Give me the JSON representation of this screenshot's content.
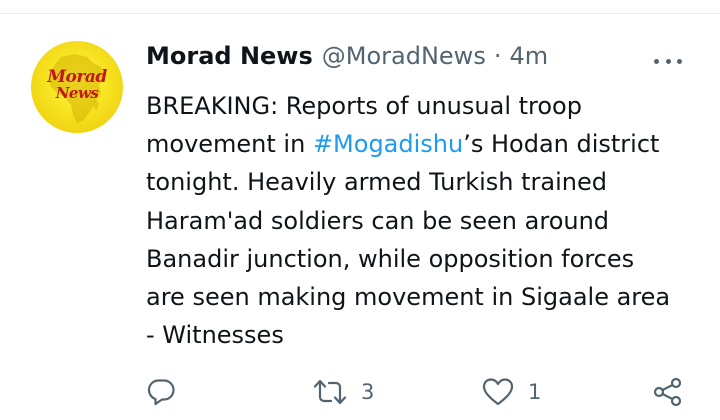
{
  "tweet": {
    "avatar": {
      "logo_line1": "Morad",
      "logo_line2": "News"
    },
    "author": {
      "display_name": "Morad News",
      "handle": "@MoradNews",
      "separator": "·",
      "time": "4m"
    },
    "text": {
      "part1": "BREAKING: Reports of unusual troop\nmovement in ",
      "hashtag": "#Mogadishu",
      "part2": "’s Hodan district\ntonight. Heavily armed Turkish trained\nHaram'ad soldiers can be seen around\nBanadir junction, while opposition forces\nare seen making movement in Sigaale area\n- Witnesses"
    },
    "actions": {
      "reply_icon": "reply-icon",
      "retweet_icon": "retweet-icon",
      "retweet_count": "3",
      "like_icon": "heart-icon",
      "like_count": "1",
      "share_icon": "share-icon"
    },
    "colors": {
      "link": "#1d9bf0",
      "secondary_text": "#536471",
      "primary_text": "#0f1419",
      "logo_red": "#c01818",
      "logo_yellow": "#f7e321"
    }
  }
}
